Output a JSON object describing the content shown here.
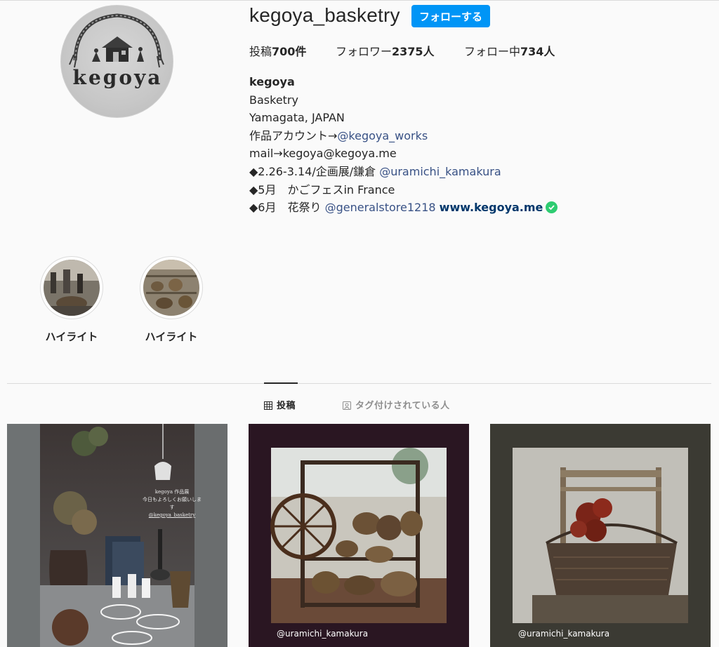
{
  "profile": {
    "username": "kegoya_basketry",
    "follow_label": "フォローする",
    "avatar_text": "kegoya"
  },
  "stats": {
    "posts_label": "投稿",
    "posts_count": "700件",
    "followers_label": "フォロワー",
    "followers_count": "2375人",
    "following_label": "フォロー中",
    "following_count": "734人"
  },
  "bio": {
    "name": "kegoya",
    "line1": "Basketry",
    "line2": "Yamagata, JAPAN",
    "line3_prefix": "作品アカウント→",
    "line3_link": "@kegoya_works",
    "line4": "mail→kegoya@kegoya.me",
    "line5_prefix": "◆2.26-3.14/企画展/鎌倉 ",
    "line5_link": "@uramichi_kamakura",
    "line6": "◆5月　かごフェスin France",
    "line7_prefix": "◆6月　花祭り ",
    "line7_link": "@generalstore1218",
    "website": "www.kegoya.me"
  },
  "highlights": [
    {
      "label": "ハイライト"
    },
    {
      "label": "ハイライト"
    }
  ],
  "tabs": {
    "posts": "投稿",
    "tagged": "タグ付けされている人"
  },
  "posts": [
    {
      "caption": "",
      "overlay_line1": "kegoya 作品展",
      "overlay_line2": "今日もよろしくお願いします",
      "overlay_line3": "@kegoya_basketry"
    },
    {
      "caption": "@uramichi_kamakura"
    },
    {
      "caption": "@uramichi_kamakura"
    }
  ],
  "colors": {
    "accent": "#0095f6",
    "link": "#385185",
    "verified": "#2ecc71",
    "background": "#fafafa"
  }
}
